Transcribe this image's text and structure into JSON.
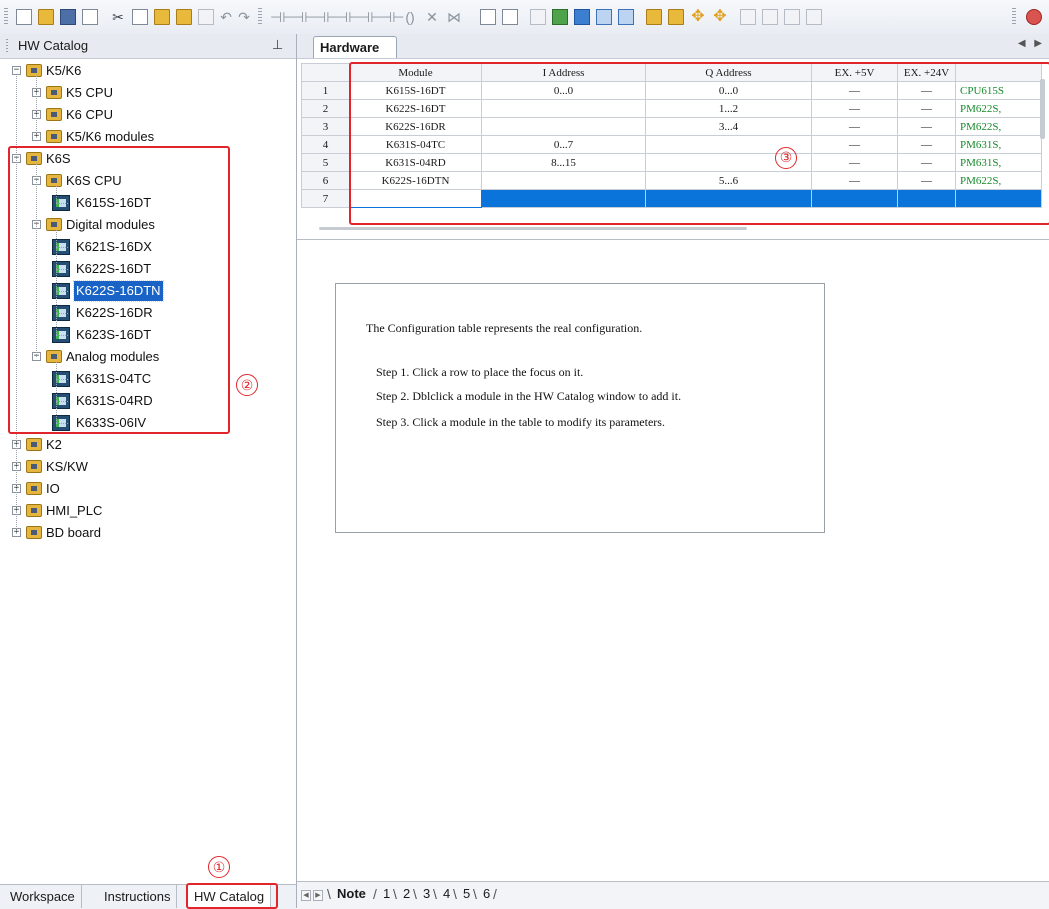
{
  "toolbar": {
    "icons": [
      "new-icon",
      "open-icon",
      "save-icon",
      "print-preview-icon",
      "cut-icon",
      "copy-icon",
      "paste-icon",
      "paste-special-icon",
      "compare-icon",
      "undo-icon",
      "redo-icon",
      "contact-icon",
      "coil-icon",
      "box-icon",
      "insert-icon",
      "delete-icon",
      "build-icon",
      "compile-icon",
      "download-icon",
      "upload-icon",
      "hardware-config-icon",
      "monitor-icon",
      "run-icon",
      "stop-icon",
      "zoom-icon"
    ]
  },
  "left_panel": {
    "title": "HW Catalog",
    "tree": [
      {
        "level": 0,
        "type": "folder",
        "label": "K5/K6",
        "expanded": true
      },
      {
        "level": 1,
        "type": "folder",
        "label": "K5 CPU",
        "expanded": false
      },
      {
        "level": 1,
        "type": "folder",
        "label": "K6 CPU",
        "expanded": false
      },
      {
        "level": 1,
        "type": "folder",
        "label": "K5/K6 modules",
        "expanded": false
      },
      {
        "level": 0,
        "type": "folder",
        "label": "K6S",
        "expanded": true
      },
      {
        "level": 1,
        "type": "folder",
        "label": "K6S CPU",
        "expanded": true
      },
      {
        "level": 2,
        "type": "module",
        "label": "K615S-16DT"
      },
      {
        "level": 1,
        "type": "folder",
        "label": "Digital modules",
        "expanded": true
      },
      {
        "level": 2,
        "type": "module",
        "label": "K621S-16DX"
      },
      {
        "level": 2,
        "type": "module",
        "label": "K622S-16DT"
      },
      {
        "level": 2,
        "type": "module",
        "label": "K622S-16DTN",
        "selected": true
      },
      {
        "level": 2,
        "type": "module",
        "label": "K622S-16DR"
      },
      {
        "level": 2,
        "type": "module",
        "label": "K623S-16DT"
      },
      {
        "level": 1,
        "type": "folder",
        "label": "Analog modules",
        "expanded": true
      },
      {
        "level": 2,
        "type": "module",
        "label": "K631S-04TC"
      },
      {
        "level": 2,
        "type": "module",
        "label": "K631S-04RD"
      },
      {
        "level": 2,
        "type": "module",
        "label": "K633S-06IV"
      },
      {
        "level": 0,
        "type": "folder",
        "label": "K2",
        "expanded": false
      },
      {
        "level": 0,
        "type": "folder",
        "label": "KS/KW",
        "expanded": false
      },
      {
        "level": 0,
        "type": "folder",
        "label": "IO",
        "expanded": false
      },
      {
        "level": 0,
        "type": "folder",
        "label": "HMI_PLC",
        "expanded": false
      },
      {
        "level": 0,
        "type": "folder",
        "label": "BD board",
        "expanded": false
      }
    ],
    "tabs": [
      "Workspace",
      "Instructions",
      "HW Catalog"
    ],
    "active_tab": "HW Catalog"
  },
  "annotations": {
    "one": "①",
    "two": "②",
    "three": "③"
  },
  "editor": {
    "tab_title": "Hardware",
    "columns": [
      "",
      "Module",
      "I Address",
      "Q Address",
      "EX. +5V",
      "EX. +24V",
      ""
    ],
    "rows": [
      [
        "1",
        "K615S-16DT",
        "0...0",
        "0...0",
        "—",
        "—",
        "CPU615S"
      ],
      [
        "2",
        "K622S-16DT",
        "",
        "1...2",
        "—",
        "—",
        "PM622S,"
      ],
      [
        "3",
        "K622S-16DR",
        "",
        "3...4",
        "—",
        "—",
        "PM622S,"
      ],
      [
        "4",
        "K631S-04TC",
        "0...7",
        "",
        "—",
        "—",
        "PM631S,"
      ],
      [
        "5",
        "K631S-04RD",
        "8...15",
        "",
        "—",
        "—",
        "PM631S,"
      ],
      [
        "6",
        "K622S-16DTN",
        "",
        "5...6",
        "—",
        "—",
        "PM622S,"
      ]
    ],
    "new_row_number": "7",
    "note": {
      "heading": "The Configuration table represents the real configuration.",
      "steps": [
        "Step 1. Click a row to place the focus on it.",
        "Step 2. Dblclick a module in the HW Catalog window to add it.",
        "Step 3. Click a module in the table to modify its parameters."
      ]
    },
    "bottom_tabs": [
      "Note",
      "1",
      "2",
      "3",
      "4",
      "5",
      "6"
    ],
    "active_bottom_tab": "Note"
  },
  "colors": {
    "annotation_red": "#e0262a",
    "selection_blue": "#1a63c6",
    "new_row_blue": "#0a74da",
    "comment_green": "#168a2c"
  }
}
